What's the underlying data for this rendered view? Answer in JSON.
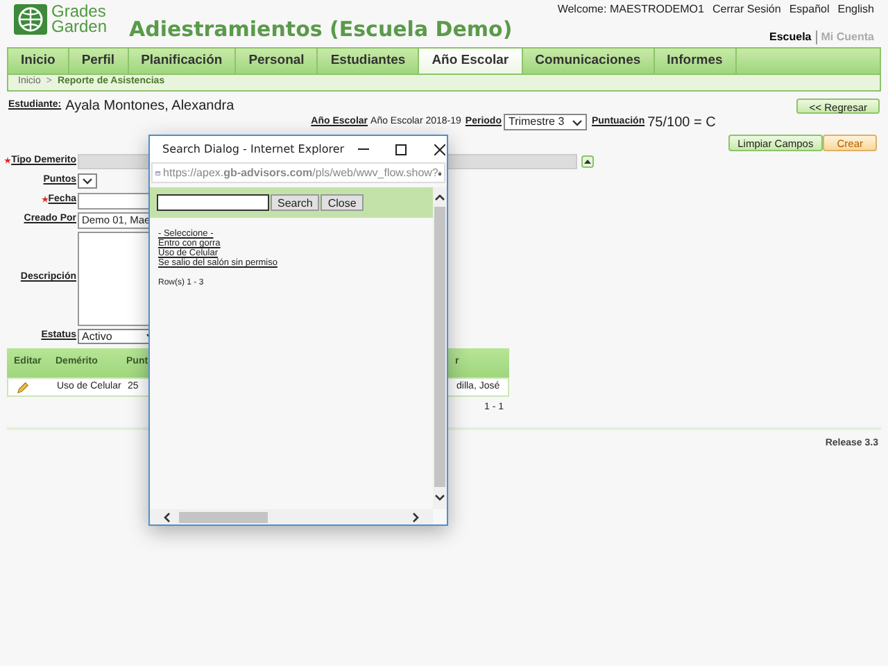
{
  "header": {
    "logo": {
      "line1": "Grades",
      "line2": "Garden"
    },
    "title": "Adiestramientos (Escuela Demo)",
    "user_links": [
      "Welcome: MAESTRODEMO1",
      "Cerrar Sesión",
      "Español",
      "English"
    ],
    "context_switch": [
      {
        "label": "Escuela",
        "selected": true
      },
      {
        "label": "Mi Cuenta",
        "selected": false
      }
    ]
  },
  "nav_tabs": [
    {
      "label": "Inicio",
      "selected": false
    },
    {
      "label": "Perfil",
      "selected": false
    },
    {
      "label": "Planificación",
      "selected": false
    },
    {
      "label": "Personal",
      "selected": false
    },
    {
      "label": "Estudiantes",
      "selected": false
    },
    {
      "label": "Año Escolar",
      "selected": true
    },
    {
      "label": "Comunicaciones",
      "selected": false
    },
    {
      "label": "Informes",
      "selected": false
    }
  ],
  "breadcrumb": {
    "items": [
      "Inicio",
      "Reporte de Asistencias"
    ],
    "separator": ">"
  },
  "student": {
    "label": "Estudiante:",
    "value": "Ayala Montones, Alexandra"
  },
  "back_button": "<< Regresar",
  "filters": {
    "school_year_label": "Año Escolar",
    "school_year": "Año Escolar 2018-19",
    "period_label": "Periodo",
    "period": "Trimestre 3",
    "score_label": "Puntuación",
    "score": "75/100 = C"
  },
  "actions": [
    {
      "label": "Limpiar Campos",
      "kind": "secondary"
    },
    {
      "label": "Crear",
      "kind": "primary"
    }
  ],
  "form": [
    {
      "label": "Tipo Demerito",
      "required": true,
      "kind": "readonly"
    },
    {
      "label": "Puntos",
      "required": false,
      "kind": "select"
    },
    {
      "label": "Fecha",
      "required": true,
      "kind": "text"
    },
    {
      "label": "Creado Por",
      "required": false,
      "kind": "text",
      "value": "Demo 01, Mae"
    },
    {
      "label": "Descripción",
      "required": false,
      "kind": "textarea"
    },
    {
      "label": "Estatus",
      "required": false,
      "kind": "select",
      "value": "Activo"
    }
  ],
  "table": {
    "columns": [
      "Editar",
      "Demérito",
      "Punt",
      "r"
    ],
    "rows": [
      {
        "cells": [
          "",
          "Uso de Celular",
          "25",
          "dilla, José"
        ]
      }
    ],
    "pagination": "1 - 1"
  },
  "footer": "Release 3.3",
  "dialog": {
    "title": "Search Dialog - Internet Explorer",
    "url": "https://apex.**gb-advisors.com**/pls/web/wwv_flow.show?",
    "search_button": "Search",
    "close_button": "Close",
    "options": [
      "- Seleccione -",
      "Entro con gorra",
      "Uso de Celular",
      "Se salio del salón sin permiso"
    ],
    "rows_info": "Row(s) 1 - 3"
  }
}
